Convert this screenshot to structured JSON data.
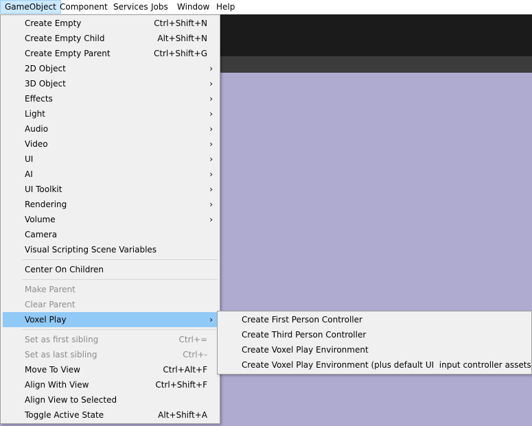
{
  "menubar": [
    "GameObject",
    "Component",
    "Services",
    "Jobs",
    "Window",
    "Help"
  ],
  "menu": {
    "items": [
      {
        "label": "Create Empty",
        "shortcut": "Ctrl+Shift+N"
      },
      {
        "label": "Create Empty Child",
        "shortcut": "Alt+Shift+N"
      },
      {
        "label": "Create Empty Parent",
        "shortcut": "Ctrl+Shift+G"
      },
      {
        "label": "2D Object",
        "arrow": "›"
      },
      {
        "label": "3D Object",
        "arrow": "›"
      },
      {
        "label": "Effects",
        "arrow": "›"
      },
      {
        "label": "Light",
        "arrow": "›"
      },
      {
        "label": "Audio",
        "arrow": "›"
      },
      {
        "label": "Video",
        "arrow": "›"
      },
      {
        "label": "UI",
        "arrow": "›"
      },
      {
        "label": "AI",
        "arrow": "›"
      },
      {
        "label": "UI Toolkit",
        "arrow": "›"
      },
      {
        "label": "Rendering",
        "arrow": "›"
      },
      {
        "label": "Volume",
        "arrow": "›"
      },
      {
        "label": "Camera"
      },
      {
        "label": "Visual Scripting Scene Variables"
      },
      {
        "label": "Center On Children"
      },
      {
        "label": "Make Parent"
      },
      {
        "label": "Clear Parent"
      },
      {
        "label": "Voxel Play",
        "arrow": "›"
      },
      {
        "label": "Set as first sibling",
        "shortcut": "Ctrl+="
      },
      {
        "label": "Set as last sibling",
        "shortcut": "Ctrl+-"
      },
      {
        "label": "Move To View",
        "shortcut": "Ctrl+Alt+F"
      },
      {
        "label": "Align With View",
        "shortcut": "Ctrl+Shift+F"
      },
      {
        "label": "Align View to Selected"
      },
      {
        "label": "Toggle Active State",
        "shortcut": "Alt+Shift+A"
      }
    ]
  },
  "submenu": {
    "items": [
      {
        "label": "Create First Person Controller"
      },
      {
        "label": "Create Third Person Controller"
      },
      {
        "label": "Create Voxel Play Environment"
      },
      {
        "label": "Create Voxel Play Environment (plus default UI  input controller assets)"
      }
    ]
  }
}
